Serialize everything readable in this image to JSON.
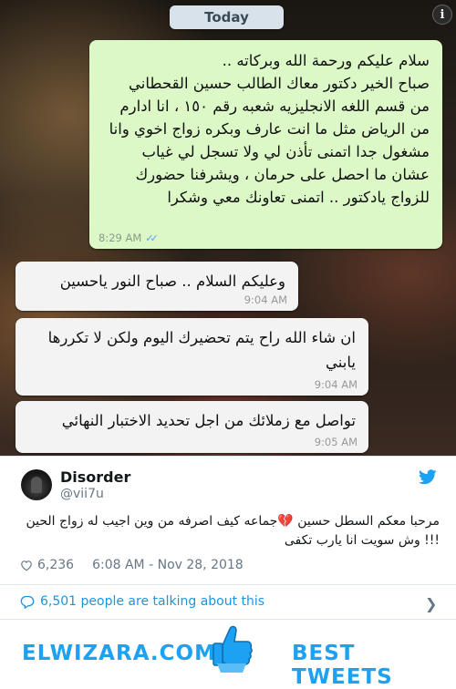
{
  "chat": {
    "date_label": "Today",
    "info_icon": "i",
    "outgoing": {
      "text": "سلام عليكم ورحمة الله  وبركاته ..\nصباح الخير دكتور معاك الطالب حسين القحطاني\nمن قسم اللغه الانجليزيه شعبه رقم ١٥٠ ، انا ادارم\nمن الرياض مثل ما انت عارف وبكره زواج اخوي وانا\nمشغول جدا اتمنى تأذن لي ولا تسجل لي غياب\nعشان ما احصل على حرمان ، ويشرفنا حضورك\nللزواج يادكتور .. اتمنى تعاونك معي وشكرا",
      "time": "8:29 AM",
      "ticks": "✓✓"
    },
    "incoming": [
      {
        "text": "وعليكم السلام .. صباح النور ياحسين",
        "time": "9:04 AM"
      },
      {
        "text": "ان شاء الله راح يتم تحضيرك اليوم ولكن لا تكررها\nيابني",
        "time": "9:04 AM"
      },
      {
        "text": "تواصل مع زملائك من اجل تحديد الاختبار النهائي",
        "time": "9:05 AM"
      }
    ]
  },
  "tweet": {
    "name": "Disorder",
    "handle": "@vii7u",
    "text": "مرحبا معكم السطل حسين 💔جماعه كيف اصرفه من وين اجيب له زواج الحين !!! وش سويت انا يارب تكفى",
    "likes": "6,236",
    "timestamp": "6:08 AM - Nov 28, 2018",
    "talking": "6,501 people are talking about this"
  },
  "footer": {
    "site": "ELWIZARA.COM",
    "tagline": "BEST TWEETS"
  },
  "colors": {
    "accent": "#1da1f2",
    "bubble_out": "#dcf8c6",
    "bubble_in": "#f3f3f3"
  }
}
